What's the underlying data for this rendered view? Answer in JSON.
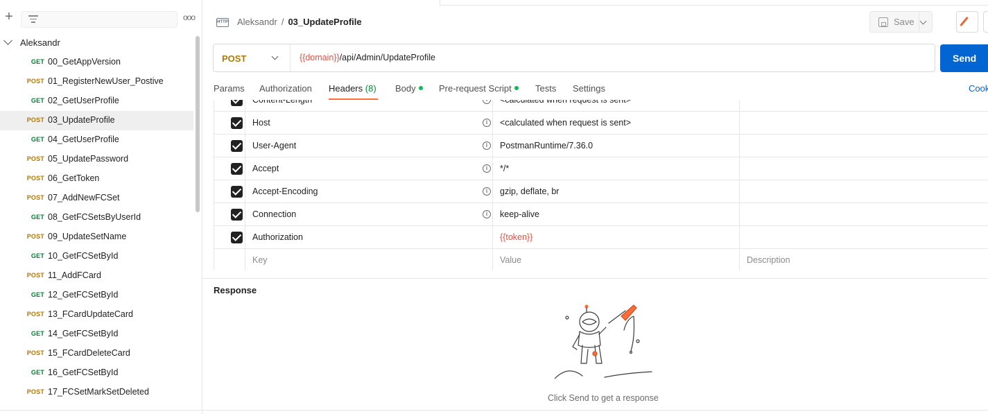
{
  "sidebar": {
    "collection_name": "Aleksandr",
    "requests": [
      {
        "method": "GET",
        "name": "00_GetAppVersion"
      },
      {
        "method": "POST",
        "name": "01_RegisterNewUser_Postive"
      },
      {
        "method": "GET",
        "name": "02_GetUserProfile"
      },
      {
        "method": "POST",
        "name": "03_UpdateProfile",
        "active": true
      },
      {
        "method": "GET",
        "name": "04_GetUserProfile"
      },
      {
        "method": "POST",
        "name": "05_UpdatePassword"
      },
      {
        "method": "POST",
        "name": "06_GetToken"
      },
      {
        "method": "POST",
        "name": "07_AddNewFCSet"
      },
      {
        "method": "GET",
        "name": "08_GetFCSetsByUserId"
      },
      {
        "method": "POST",
        "name": "09_UpdateSetName"
      },
      {
        "method": "GET",
        "name": "10_GetFCSetById"
      },
      {
        "method": "POST",
        "name": "11_AddFCard"
      },
      {
        "method": "GET",
        "name": "12_GetFCSetById"
      },
      {
        "method": "POST",
        "name": "13_FCardUpdateCard"
      },
      {
        "method": "GET",
        "name": "14_GetFCSetById"
      },
      {
        "method": "POST",
        "name": "15_FCardDeleteCard"
      },
      {
        "method": "GET",
        "name": "16_GetFCSetById"
      },
      {
        "method": "POST",
        "name": "17_FCSetMarkSetDeleted"
      }
    ],
    "icons": {
      "add": "plus-icon",
      "filter": "filter-icon",
      "more": "more-icon"
    }
  },
  "header": {
    "http_badge": "HTTP",
    "collection": "Aleksandr",
    "separator": "/",
    "request_name": "03_UpdateProfile",
    "save_label": "Save"
  },
  "url_bar": {
    "method": "POST",
    "url_var": "{{domain}}",
    "url_path": "/api/Admin/UpdateProfile",
    "send_label": "Send"
  },
  "request_tabs": {
    "params": "Params",
    "authorization": "Authorization",
    "headers": "Headers",
    "headers_count": "(8)",
    "body": "Body",
    "pre_request": "Pre-request Script",
    "tests": "Tests",
    "settings": "Settings",
    "cookies": "Cook"
  },
  "headers_table": {
    "rows": [
      {
        "key": "Content-Length",
        "value": "<calculated when request is sent>",
        "is_var": false
      },
      {
        "key": "Host",
        "value": "<calculated when request is sent>",
        "is_var": false
      },
      {
        "key": "User-Agent",
        "value": "PostmanRuntime/7.36.0",
        "is_var": false
      },
      {
        "key": "Accept",
        "value": "*/*",
        "is_var": false
      },
      {
        "key": "Accept-Encoding",
        "value": "gzip, deflate, br",
        "is_var": false
      },
      {
        "key": "Connection",
        "value": "keep-alive",
        "is_var": false
      },
      {
        "key": "Authorization",
        "value": "{{token}}",
        "is_var": true
      }
    ],
    "placeholders": {
      "key": "Key",
      "value": "Value",
      "description": "Description"
    }
  },
  "response": {
    "title": "Response",
    "hint": "Click Send to get a response"
  },
  "colors": {
    "get": "#007f31",
    "post": "#ad7a03",
    "send": "#0265d2",
    "variable": "#e05243",
    "tab_underline": "#ff6c37"
  }
}
